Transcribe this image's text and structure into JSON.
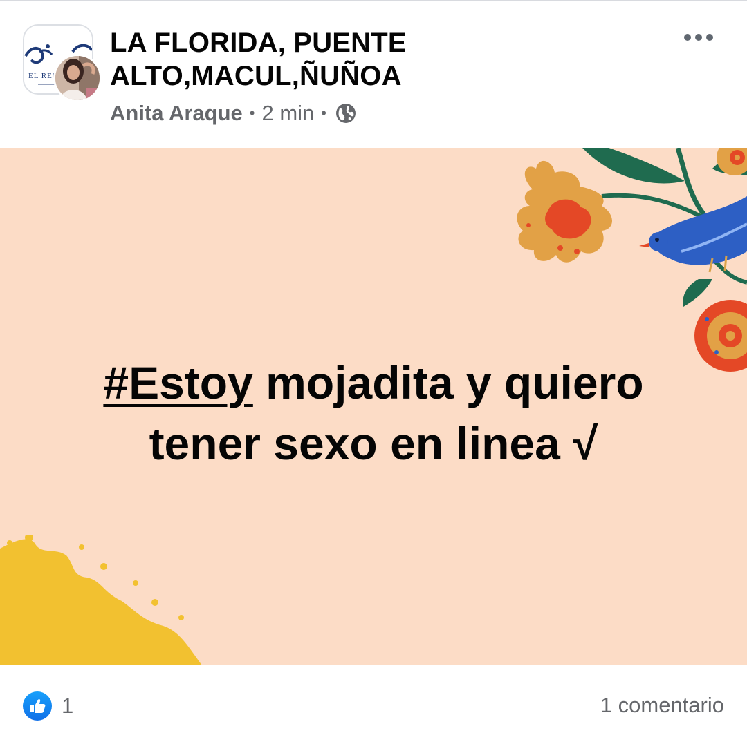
{
  "header": {
    "group_name_line1": "LA FLORIDA, PUENTE",
    "group_name_line2": "ALTO,MACUL,ÑUÑOA",
    "author": "Anita Araque",
    "separator": "•",
    "time": "2 min",
    "privacy_icon": "globe-icon",
    "more_icon": "more-horizontal-icon"
  },
  "post": {
    "hashtag": "#Estoy",
    "text_line1_rest": " mojadita y quiero",
    "text_line2": "tener sexo en linea √",
    "background_color": "#fcdcc6"
  },
  "footer": {
    "reaction_icon": "like-icon",
    "reaction_count": "1",
    "comments": "1 comentario"
  },
  "colors": {
    "text_primary": "#050505",
    "text_secondary": "#65676b",
    "like_blue": "#1877f2"
  }
}
